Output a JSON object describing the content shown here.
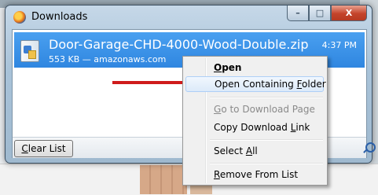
{
  "window": {
    "title": "Downloads",
    "controls": {
      "minimize": "–",
      "maximize": "□",
      "close": "X"
    }
  },
  "download": {
    "filename": "Door-Garage-CHD-4000-Wood-Double.zip",
    "meta": "553 KB — amazonaws.com",
    "time": "4:37 PM",
    "icon": "zip-file-icon"
  },
  "footer": {
    "clear_label": "Clear List",
    "search_icon": "search-icon"
  },
  "context_menu": {
    "items": [
      {
        "pre": "",
        "u": "O",
        "post": "pen"
      },
      {
        "pre": "Open Containing ",
        "u": "F",
        "post": "older"
      },
      {
        "pre": "",
        "u": "G",
        "post": "o to Download Page"
      },
      {
        "pre": "Copy Download ",
        "u": "L",
        "post": "ink"
      },
      {
        "pre": "Select ",
        "u": "A",
        "post": "ll"
      },
      {
        "pre": "",
        "u": "R",
        "post": "emove From List"
      }
    ]
  },
  "colors": {
    "selection": "#3a8fe8",
    "arrow": "#cf1b1b"
  }
}
